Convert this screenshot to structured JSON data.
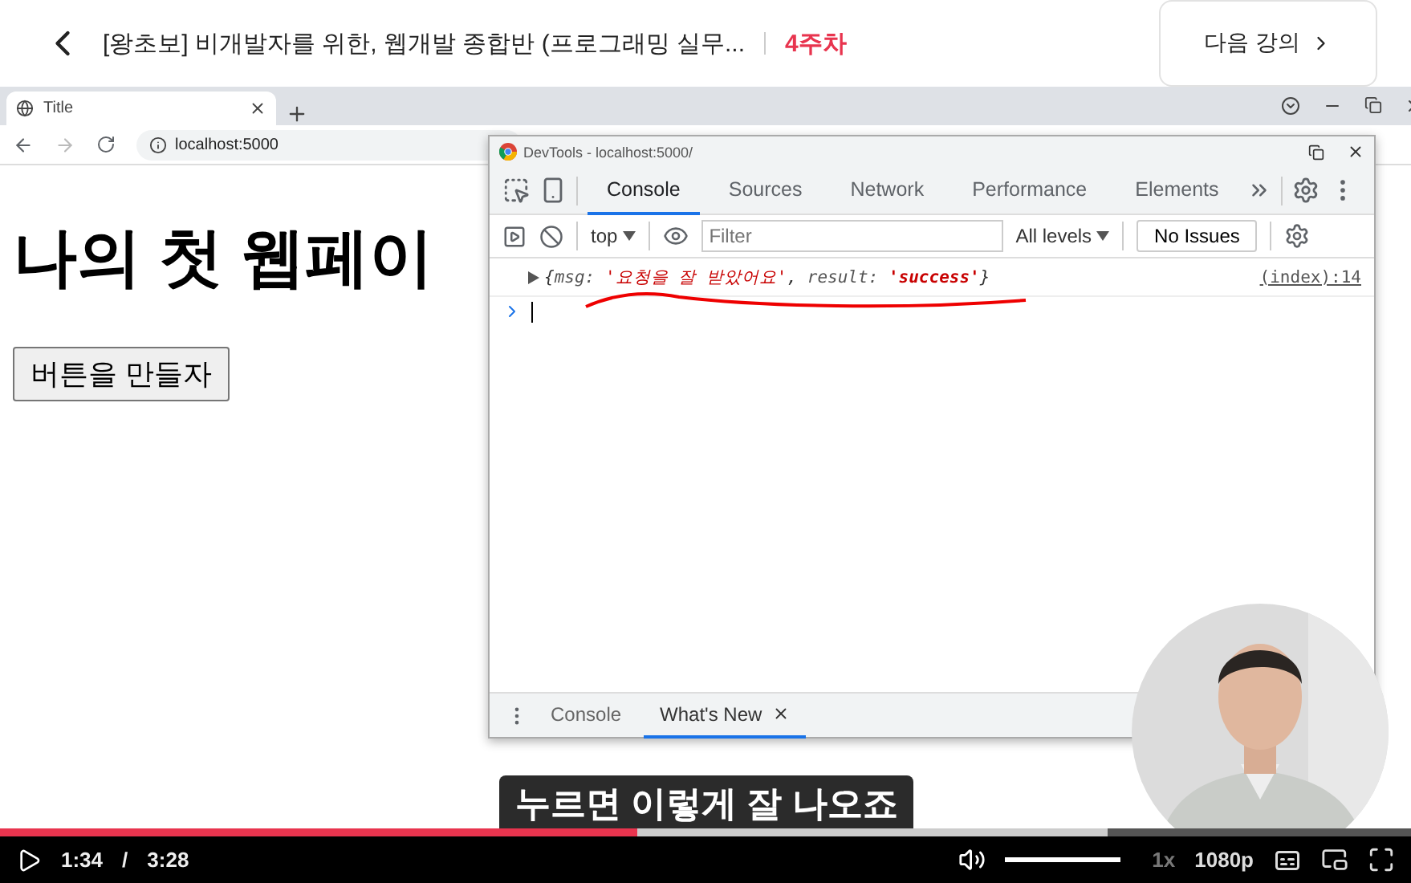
{
  "header": {
    "title": "[왕초보] 비개발자를 위한, 웹개발 종합반 (프로그래밍 실무...",
    "week": "4주차",
    "next_button": "다음 강의"
  },
  "browser": {
    "tab": {
      "title": "Title"
    },
    "address": "localhost:5000",
    "page": {
      "heading": "나의 첫 웹페이",
      "button": "버튼을 만들자"
    }
  },
  "devtools": {
    "title": "DevTools - localhost:5000/",
    "tabs": [
      {
        "label": "Console",
        "selected": true
      },
      {
        "label": "Sources",
        "selected": false
      },
      {
        "label": "Network",
        "selected": false
      },
      {
        "label": "Performance",
        "selected": false
      },
      {
        "label": "Elements",
        "selected": false
      }
    ],
    "context": "top",
    "filter": {
      "placeholder": "Filter"
    },
    "levels": "All levels",
    "issues": "No Issues",
    "log": {
      "parts": [
        {
          "kind": "punct",
          "text": "{"
        },
        {
          "kind": "key",
          "text": "msg: "
        },
        {
          "kind": "string",
          "text": "'요청을 잘 받았어요'"
        },
        {
          "kind": "punct",
          "text": ", "
        },
        {
          "kind": "key",
          "text": "result: "
        },
        {
          "kind": "string",
          "text": "'success'"
        },
        {
          "kind": "punct",
          "text": "}"
        }
      ],
      "source": "(index):14"
    },
    "drawer_tabs": [
      {
        "label": "Console",
        "selected": false,
        "closable": false
      },
      {
        "label": "What's New",
        "selected": true,
        "closable": true
      }
    ]
  },
  "subtitle": "누르면 이렇게 잘 나오죠",
  "player": {
    "progress": {
      "level": 0.452
    },
    "buffered": {
      "level": 0.785
    },
    "current": "1:34",
    "separator": "/",
    "duration": "3:28",
    "volume": {
      "level": 1
    },
    "speed": "1x",
    "quality": "1080p"
  }
}
